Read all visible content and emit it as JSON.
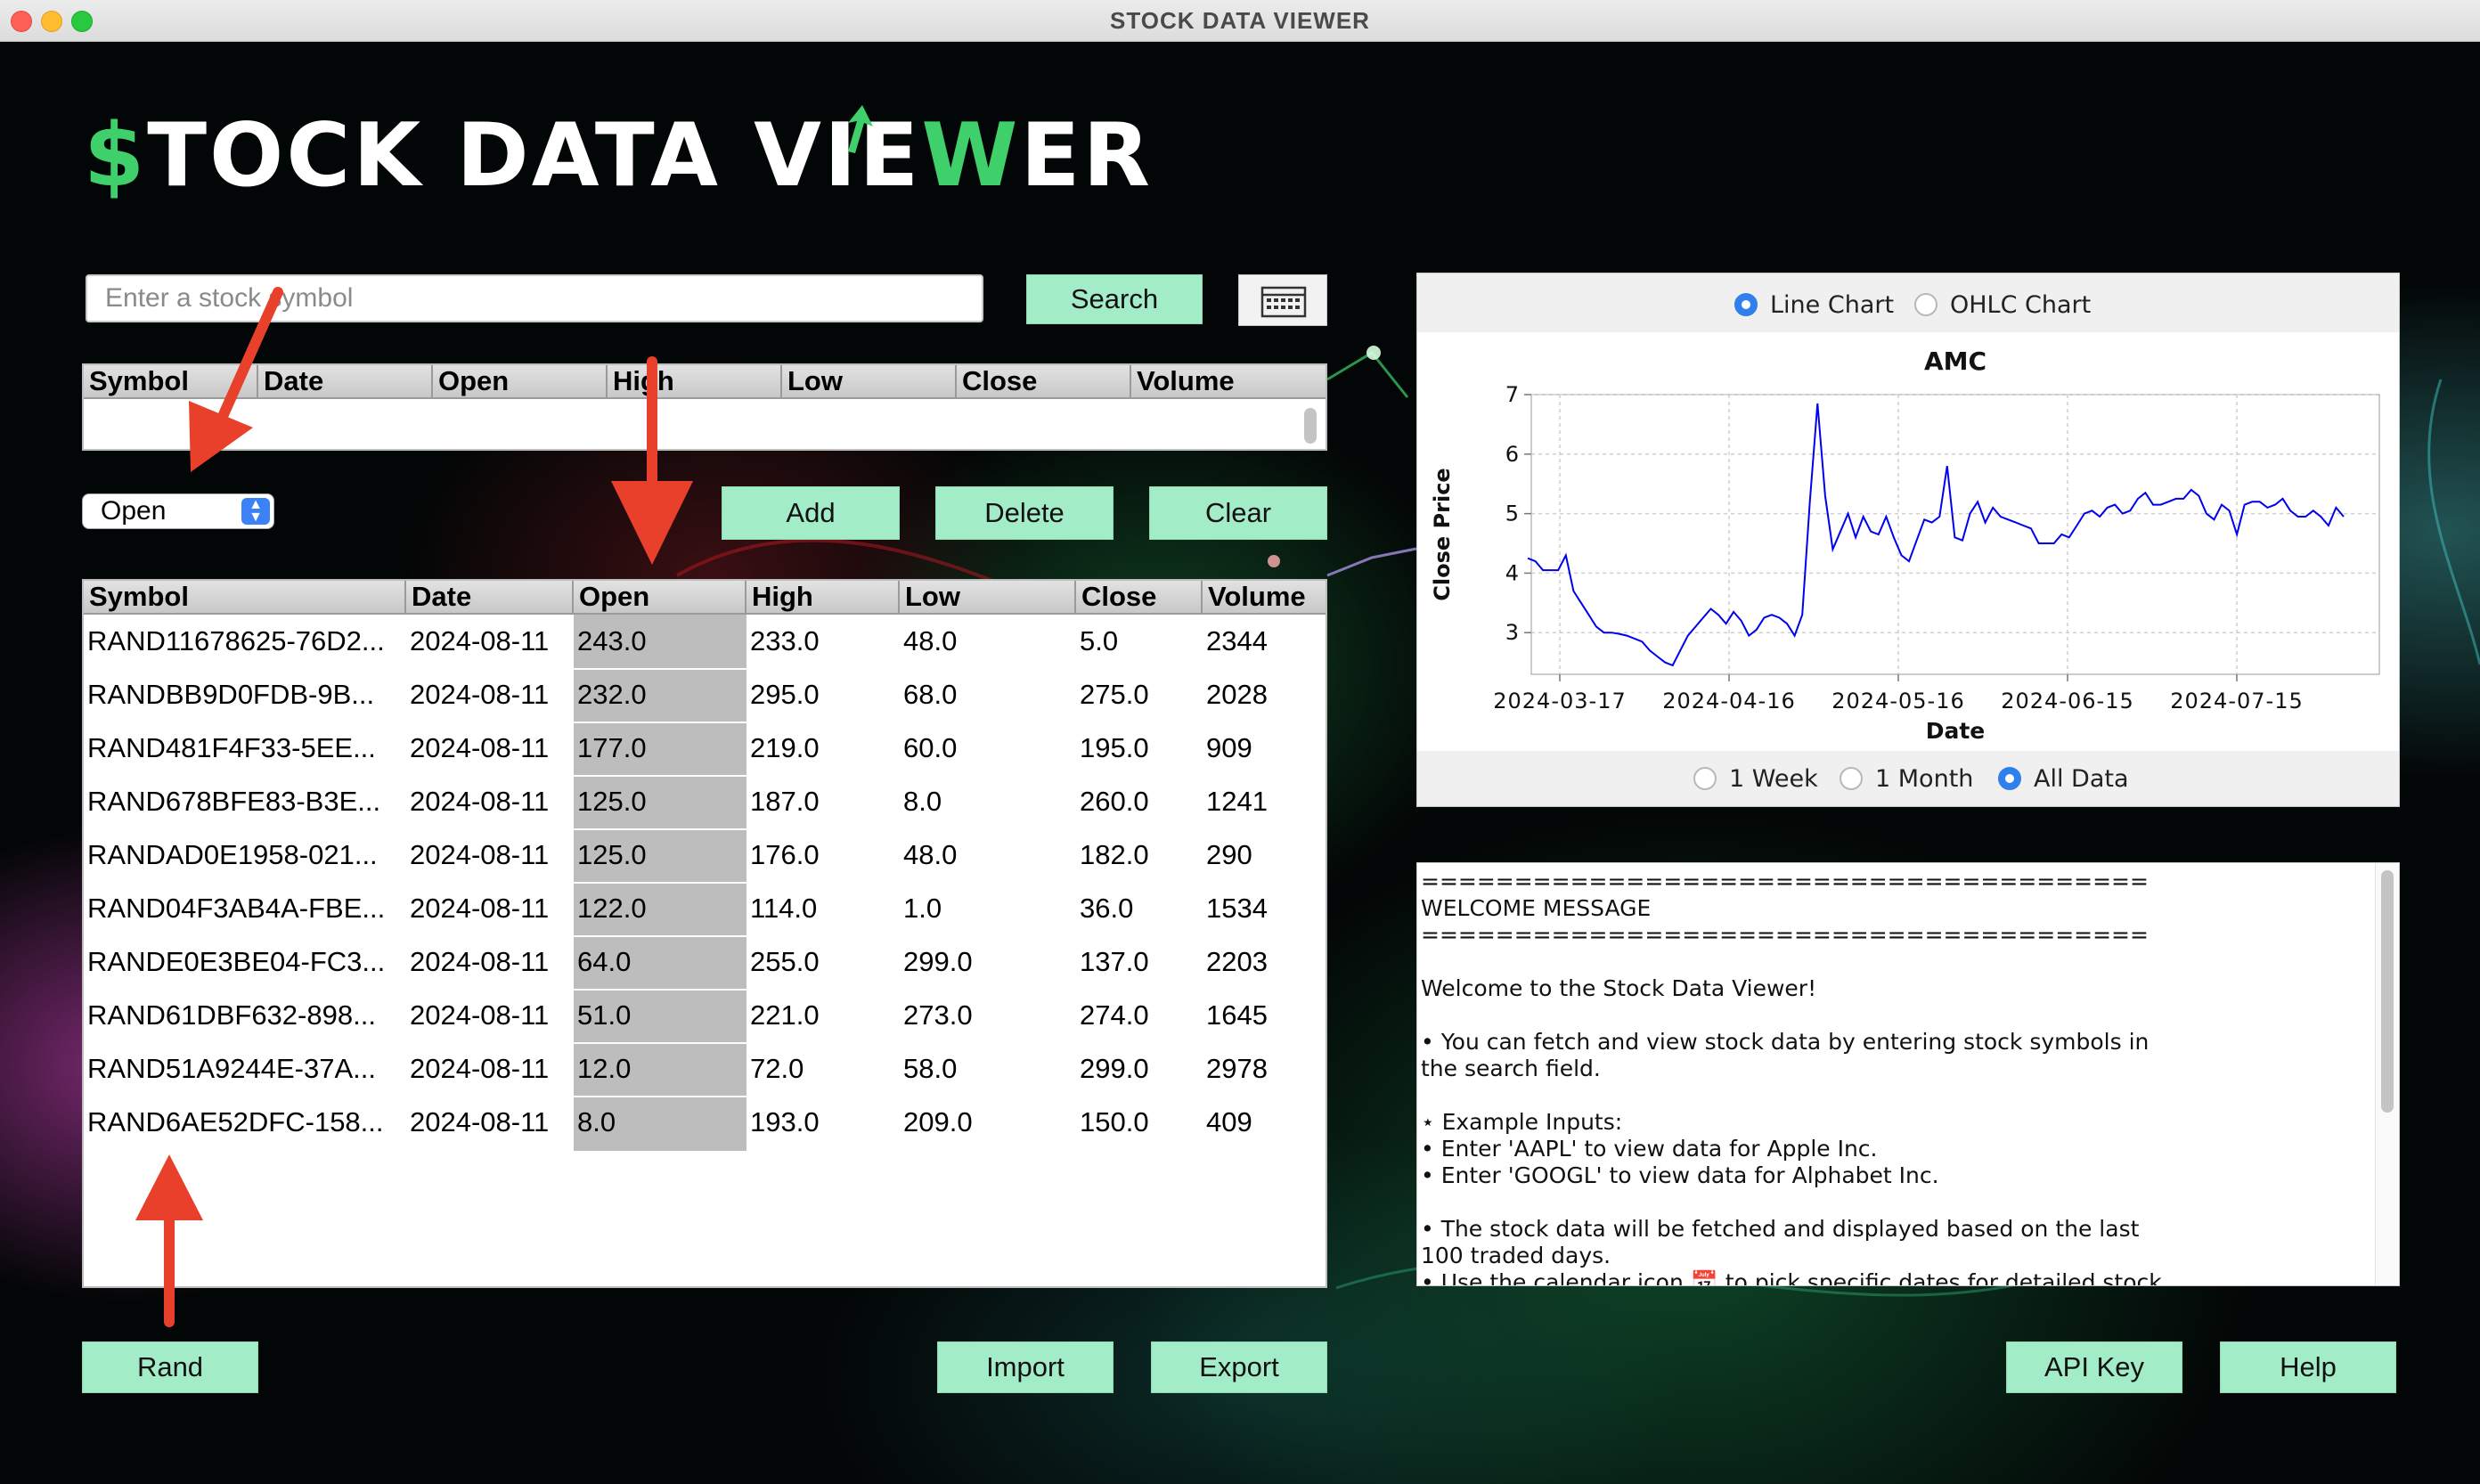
{
  "window": {
    "title": "STOCK DATA VIEWER"
  },
  "logo": {
    "dollar": "$",
    "part1": "TOCK DATA VIE",
    "w": "W",
    "part2": "ER"
  },
  "search": {
    "placeholder": "Enter a stock symbol",
    "button": "Search"
  },
  "calendar_icon": "calendar-icon",
  "top_table": {
    "columns": [
      "Symbol",
      "Date",
      "Open",
      "High",
      "Low",
      "Close",
      "Volume"
    ]
  },
  "sort_dropdown": {
    "selected": "Open"
  },
  "actions": {
    "add": "Add",
    "delete": "Delete",
    "clear": "Clear"
  },
  "main_table": {
    "columns": [
      "Symbol",
      "Date",
      "Open",
      "High",
      "Low",
      "Close",
      "Volume"
    ],
    "selected_column": "Open",
    "rows": [
      [
        "RAND11678625-76D2...",
        "2024-08-11",
        "243.0",
        "233.0",
        "48.0",
        "5.0",
        "2344"
      ],
      [
        "RANDBB9D0FDB-9B...",
        "2024-08-11",
        "232.0",
        "295.0",
        "68.0",
        "275.0",
        "2028"
      ],
      [
        "RAND481F4F33-5EE...",
        "2024-08-11",
        "177.0",
        "219.0",
        "60.0",
        "195.0",
        "909"
      ],
      [
        "RAND678BFE83-B3E...",
        "2024-08-11",
        "125.0",
        "187.0",
        "8.0",
        "260.0",
        "1241"
      ],
      [
        "RANDAD0E1958-021...",
        "2024-08-11",
        "125.0",
        "176.0",
        "48.0",
        "182.0",
        "290"
      ],
      [
        "RAND04F3AB4A-FBE...",
        "2024-08-11",
        "122.0",
        "114.0",
        "1.0",
        "36.0",
        "1534"
      ],
      [
        "RANDE0E3BE04-FC3...",
        "2024-08-11",
        "64.0",
        "255.0",
        "299.0",
        "137.0",
        "2203"
      ],
      [
        "RAND61DBF632-898...",
        "2024-08-11",
        "51.0",
        "221.0",
        "273.0",
        "274.0",
        "1645"
      ],
      [
        "RAND51A9244E-37A...",
        "2024-08-11",
        "12.0",
        "72.0",
        "58.0",
        "299.0",
        "2978"
      ],
      [
        "RAND6AE52DFC-158...",
        "2024-08-11",
        "8.0",
        "193.0",
        "209.0",
        "150.0",
        "409"
      ]
    ]
  },
  "bottom_buttons": {
    "rand": "Rand",
    "import": "Import",
    "export": "Export",
    "api_key": "API Key",
    "help": "Help"
  },
  "chart_options": {
    "line": "Line Chart",
    "ohlc": "OHLC Chart",
    "selected": "line"
  },
  "range_options": {
    "week": "1 Week",
    "month": "1 Month",
    "all": "All Data",
    "selected": "all"
  },
  "chart_data": {
    "type": "line",
    "title": "AMC",
    "xlabel": "Date",
    "ylabel": "Close Price",
    "ylim": [
      2.3,
      7.0
    ],
    "yticks": [
      3,
      4,
      5,
      6,
      7
    ],
    "xticks": [
      "2024-03-17",
      "2024-04-16",
      "2024-05-16",
      "2024-06-15",
      "2024-07-15"
    ],
    "grid": true,
    "line_color": "#0000ee",
    "series": [
      {
        "values": [
          4.25,
          4.2,
          4.05,
          4.05,
          4.05,
          4.3,
          3.7,
          3.5,
          3.3,
          3.1,
          3.0,
          3.0,
          2.98,
          2.95,
          2.9,
          2.85,
          2.7,
          2.6,
          2.5,
          2.45,
          2.7,
          2.95,
          3.1,
          3.25,
          3.4,
          3.3,
          3.15,
          3.35,
          3.2,
          2.95,
          3.05,
          3.25,
          3.3,
          3.25,
          3.15,
          2.95,
          3.3,
          5.2,
          6.85,
          5.3,
          4.4,
          4.7,
          5.0,
          4.6,
          4.95,
          4.7,
          4.65,
          4.95,
          4.6,
          4.3,
          4.2,
          4.55,
          4.9,
          4.85,
          4.95,
          5.8,
          4.6,
          4.55,
          5.0,
          5.2,
          4.85,
          5.1,
          4.95,
          4.9,
          4.85,
          4.8,
          4.75,
          4.5,
          4.5,
          4.5,
          4.65,
          4.6,
          4.8,
          5.0,
          5.05,
          4.95,
          5.1,
          5.15,
          5.0,
          5.05,
          5.25,
          5.35,
          5.15,
          5.15,
          5.2,
          5.25,
          5.25,
          5.4,
          5.3,
          5.0,
          4.9,
          5.15,
          5.05,
          4.65,
          5.15,
          5.2,
          5.2,
          5.1,
          5.15,
          5.25,
          5.05,
          4.95,
          4.95,
          5.05,
          4.95,
          4.8,
          5.1,
          4.95
        ]
      }
    ]
  },
  "message": {
    "lines": [
      "=======================================",
      "        WELCOME MESSAGE",
      "=======================================",
      "",
      "Welcome to the Stock Data Viewer!",
      "",
      "• You can fetch and view stock data by entering stock symbols in",
      "  the search field.",
      "",
      "⋆ Example Inputs:",
      "  • Enter 'AAPL' to view data for Apple Inc.",
      "  • Enter 'GOOGL' to view data for Alphabet Inc.",
      "",
      "• The stock data will be fetched and displayed based on the last",
      "  100 traded days.",
      "• Use the calendar icon 📅 to pick specific dates for detailed stock"
    ]
  },
  "colors": {
    "accent": "#a2ecc8",
    "logo_green": "#3fd06b",
    "annotation_red": "#e8402a",
    "radio_blue": "#2f80ed"
  }
}
